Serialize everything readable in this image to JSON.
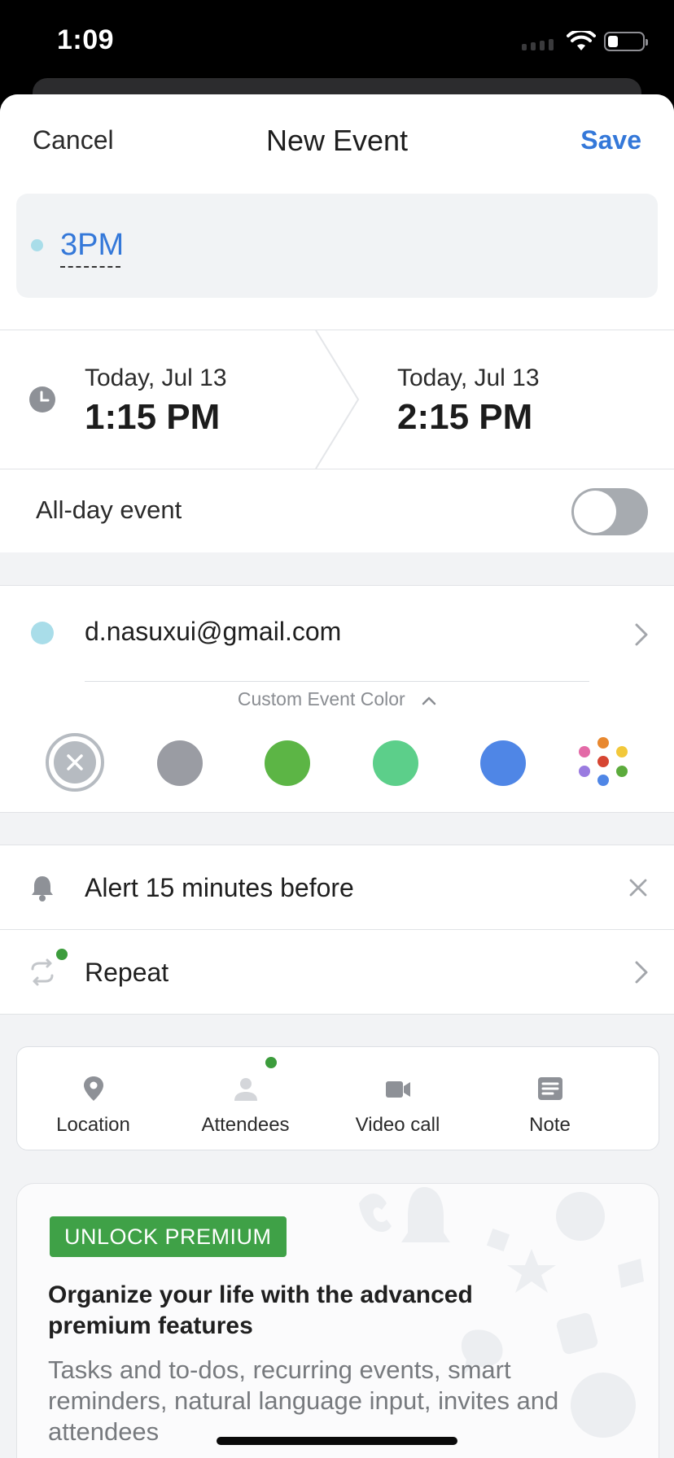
{
  "status_bar": {
    "time": "1:09",
    "battery_level": 0.3
  },
  "nav": {
    "cancel": "Cancel",
    "title": "New Event",
    "save": "Save"
  },
  "event": {
    "title": "3PM"
  },
  "start": {
    "date": "Today, Jul 13",
    "time": "1:15 PM"
  },
  "end": {
    "date": "Today, Jul 13",
    "time": "2:15 PM"
  },
  "all_day": {
    "label": "All-day event",
    "enabled": false
  },
  "calendar": {
    "account": "d.nasuxui@gmail.com",
    "custom_color_label": "Custom Event Color",
    "swatches": [
      "#9a9ca3",
      "#5cb545",
      "#5ccf8a",
      "#4f86e6"
    ]
  },
  "alert": {
    "label": "Alert 15 minutes before"
  },
  "repeat": {
    "label": "Repeat"
  },
  "options": [
    {
      "icon": "location-pin-icon",
      "label": "Location"
    },
    {
      "icon": "person-icon",
      "label": "Attendees"
    },
    {
      "icon": "video-camera-icon",
      "label": "Video call"
    },
    {
      "icon": "note-icon",
      "label": "Note"
    }
  ],
  "premium": {
    "badge": "UNLOCK PREMIUM",
    "headline": "Organize your life with the advanced premium features",
    "description": "Tasks and to-dos, recurring events, smart reminders, natural language input, invites and attendees"
  },
  "colors": {
    "accent": "#3478d9",
    "premium_green": "#3fa147",
    "dot_green": "#3c9c3c"
  }
}
